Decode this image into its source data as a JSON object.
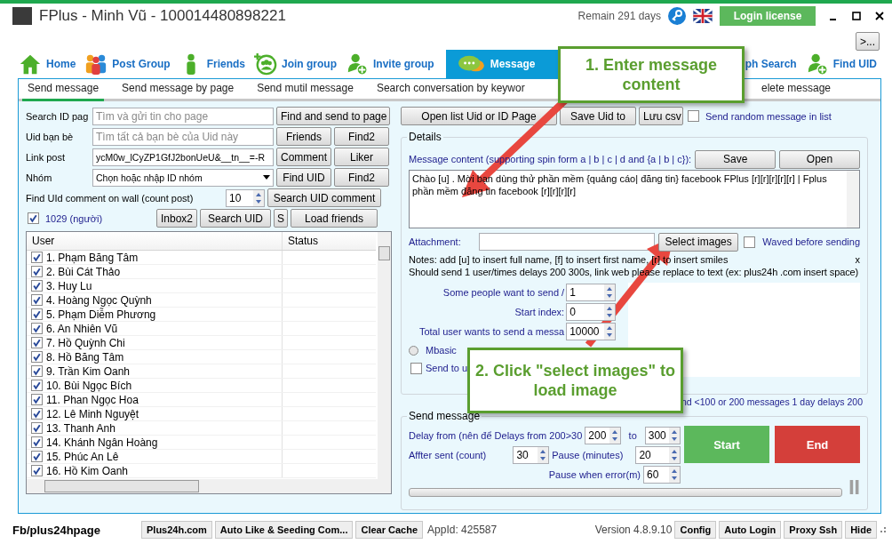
{
  "window": {
    "title": "FPlus - Minh Vũ - 100014480898221",
    "remain": "Remain 291 days",
    "login_button": "Login license"
  },
  "more_button": ">...",
  "nav": [
    {
      "label": "Home",
      "selected": false
    },
    {
      "label": "Post Group",
      "selected": false
    },
    {
      "label": "Friends",
      "selected": false
    },
    {
      "label": "Join group",
      "selected": false
    },
    {
      "label": "Invite group",
      "selected": false
    },
    {
      "label": "Message",
      "selected": true
    },
    {
      "label": "ph Search",
      "selected": false
    },
    {
      "label": "Find UID",
      "selected": false
    }
  ],
  "subtabs": [
    {
      "label": "Send message",
      "selected": true
    },
    {
      "label": "Send message by page",
      "selected": false
    },
    {
      "label": "Send mutil message",
      "selected": false
    },
    {
      "label": "Search conversation by keywor",
      "selected": false
    },
    {
      "label": "elete message",
      "selected": false
    }
  ],
  "page_search": {
    "label": "Search ID pag",
    "placeholder": "Tìm và gửi tin cho page",
    "button": "Find and send to page"
  },
  "friend_uid": {
    "label": "Uid bạn bè",
    "placeholder": "Tìm tất cả bạn bè của Uid này",
    "buttons": [
      "Friends",
      "Find2"
    ]
  },
  "link_post": {
    "label": "Link post",
    "value": "ycM0w_lCyZP1GfJ2bonUeU&__tn__=-R",
    "buttons": [
      "Comment",
      "Liker"
    ]
  },
  "group": {
    "label": "Nhóm",
    "value": "Chọn hoặc nhập ID nhóm",
    "buttons": [
      "Find UID",
      "Find2"
    ]
  },
  "comment_count": {
    "label": "Find UId comment on wall (count post)",
    "value": "10",
    "button": "Search UID comment"
  },
  "select_all": {
    "label": "1029 (người)",
    "checked": true,
    "buttons": [
      "Inbox2",
      "Search UID",
      "S",
      "Load friends"
    ]
  },
  "user_table": {
    "columns": [
      "User",
      "Status"
    ],
    "rows": [
      {
        "name": "1. Phạm Băng Tâm",
        "checked": true
      },
      {
        "name": "2. Bùi Cát Thảo",
        "checked": true
      },
      {
        "name": "3. Huy Lu",
        "checked": true
      },
      {
        "name": "4. Hoàng Ngọc Quỳnh",
        "checked": true
      },
      {
        "name": "5. Phạm Diễm Phương",
        "checked": true
      },
      {
        "name": "6. An Nhiên Vũ",
        "checked": true
      },
      {
        "name": "7. Hồ Quỳnh Chi",
        "checked": true
      },
      {
        "name": "8. Hồ Băng Tâm",
        "checked": true
      },
      {
        "name": "9. Trần Kim Oanh",
        "checked": true
      },
      {
        "name": "10. Bùi Ngọc Bích",
        "checked": true
      },
      {
        "name": "11. Phan Ngọc Hoa",
        "checked": true
      },
      {
        "name": "12. Lê Minh Nguyệt",
        "checked": true
      },
      {
        "name": "13. Thanh Anh",
        "checked": true
      },
      {
        "name": "14. Khánh Ngân Hoàng",
        "checked": true
      },
      {
        "name": "15. Phúc An Lê",
        "checked": true
      },
      {
        "name": "16. Hồ Kim Oanh",
        "checked": true
      }
    ]
  },
  "list_buttons": [
    "Open list Uid or ID Page",
    "Save Uid to",
    "Lưu csv"
  ],
  "random_message": {
    "label": "Send random message in list",
    "checked": false
  },
  "details": {
    "legend": "Details",
    "content_label": "Message content (supporting spin form a | b | c | d and {a | b | c}):",
    "buttons": [
      "Save",
      "Open"
    ],
    "message": "Chào [u] . Mời bạn dùng thử phần mềm {quảng cáo| đăng tin} facebook FPlus [r][r][r][r][r] | Fplus phần mềm đăng tin facebook [r][r][r][r]",
    "attachment_label": "Attachment:",
    "select_button": "Select images",
    "waved": {
      "label": "Waved before sending",
      "checked": false
    },
    "notes": "Notes: add [u] to insert full name, [f] to insert first name, [r] to insert smiles",
    "close": "x",
    "advice": "Should send 1 user/times delays 200 300s, link web please replace to text (ex: plus24h .com insert space)",
    "fields": [
      {
        "label": "Some people want to send /",
        "value": "1"
      },
      {
        "label": "Start index:",
        "value": "0"
      },
      {
        "label": "Total user wants to send a messa",
        "value": "10000"
      }
    ],
    "mbasic": {
      "label": "Mbasic",
      "selected": false
    },
    "send_to": {
      "label": "Send to u",
      "checked": false
    },
    "limit_note": "nd <100 or 200 messages 1 day delays 200"
  },
  "send": {
    "legend": "Send message",
    "delay_label": "Delay from (nên để Delays from 200>30",
    "delay_from": "200",
    "to_label": "to",
    "delay_to": "300",
    "after_label": "Affter sent (count)",
    "after_value": "30",
    "pause_label": "Pause (minutes)",
    "pause_value": "20",
    "error_label": "Pause when error(m)",
    "error_value": "60",
    "start": "Start",
    "end": "End",
    "progress": {
      "level": 0
    }
  },
  "status": {
    "link": "Fb/plus24hpage",
    "buttons": [
      "Plus24h.com",
      "Auto Like & Seeding Com...",
      "Clear Cache"
    ],
    "app_id": "AppId: 425587",
    "version": "Version 4.8.9.10",
    "right_buttons": [
      "Config",
      "Auto Login",
      "Proxy Ssh",
      "Hide"
    ]
  },
  "callouts": [
    "1. Enter message content",
    "2. Click \"select images\" to load image"
  ]
}
